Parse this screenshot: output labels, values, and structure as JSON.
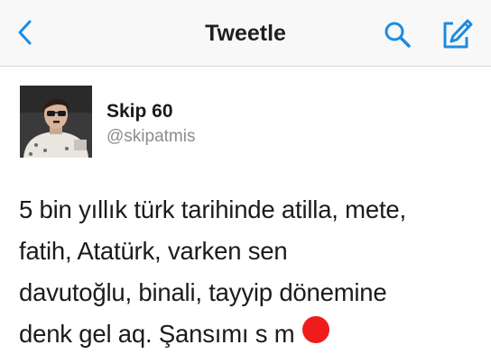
{
  "nav": {
    "back_icon": "chevron-left-icon",
    "title": "Tweetle",
    "search_icon": "search-icon",
    "compose_icon": "compose-tweet-icon",
    "accent_color": "#1d8be0"
  },
  "tweet": {
    "author": {
      "display_name": "Skip 60",
      "handle": "@skipatmis"
    },
    "text_lines": [
      "5 bin yıllık türk tarihinde atilla, mete,",
      "fatih, Atatürk, varken sen",
      "davutoğlu, binali, tayyip dönemine",
      "denk gel aq. Şansımı s   m"
    ],
    "redaction_color": "#ee1c1c"
  }
}
